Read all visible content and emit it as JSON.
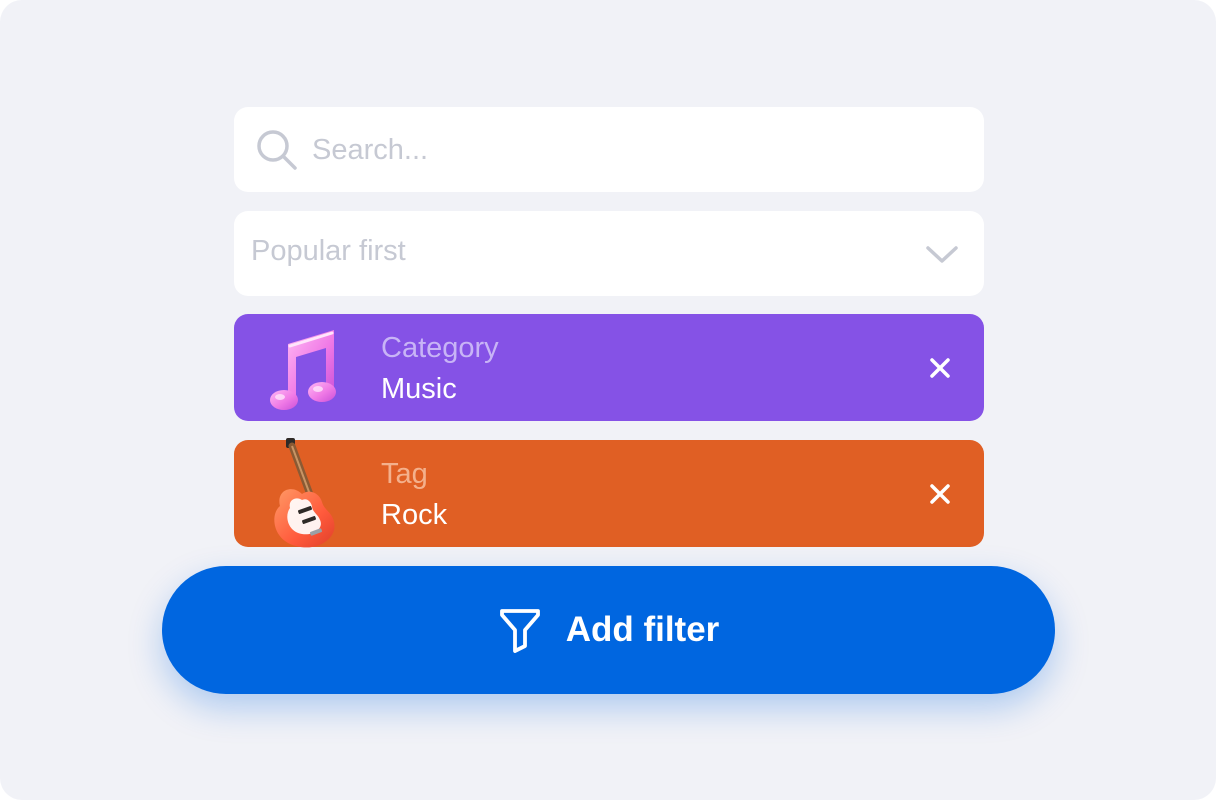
{
  "search": {
    "placeholder": "Search...",
    "icon": "search-icon"
  },
  "sort": {
    "selected": "Popular first",
    "icon": "chevron-down-icon"
  },
  "filters": [
    {
      "title": "Category",
      "value": "Music",
      "icon": "music-note-icon",
      "color": "#8552e6"
    },
    {
      "title": "Tag",
      "value": "Rock",
      "icon": "electric-guitar-icon",
      "color": "#e05f24"
    }
  ],
  "add_filter": {
    "label": "Add filter",
    "icon": "funnel-icon",
    "color": "#0066e0"
  }
}
